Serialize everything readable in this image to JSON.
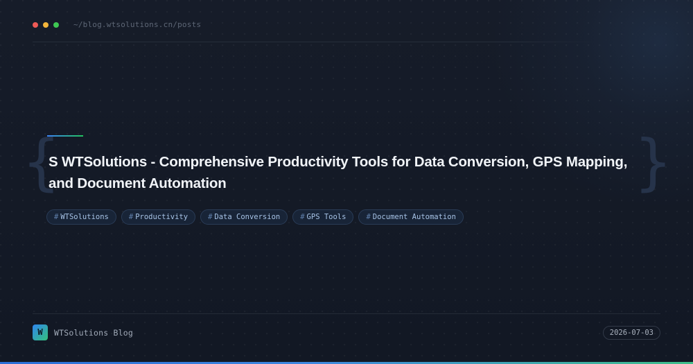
{
  "header": {
    "window_controls": [
      "close",
      "minimize",
      "maximize"
    ],
    "url": "~/blog.wtsolutions.cn/posts"
  },
  "post": {
    "braces": {
      "open": "{",
      "close": "}"
    },
    "title": "S WTSolutions - Comprehensive Productivity Tools for Data Conversion, GPS Mapping, and Document Automation",
    "tags": [
      {
        "hash": "#",
        "label": "WTSolutions"
      },
      {
        "hash": "#",
        "label": "Productivity"
      },
      {
        "hash": "#",
        "label": "Data Conversion"
      },
      {
        "hash": "#",
        "label": "GPS Tools"
      },
      {
        "hash": "#",
        "label": "Document Automation"
      }
    ]
  },
  "footer": {
    "logo_letter": "W",
    "brand": "WTSolutions Blog",
    "date": "2026-07-03"
  },
  "colors": {
    "background": "#141a26",
    "dot_red": "#ee5a56",
    "dot_yellow": "#f3b53b",
    "dot_green": "#3ec853",
    "accent_blue": "#3b82f6",
    "accent_green": "#22c55e",
    "tag_text": "#a7c3e6",
    "tag_border": "#2a3c57"
  }
}
